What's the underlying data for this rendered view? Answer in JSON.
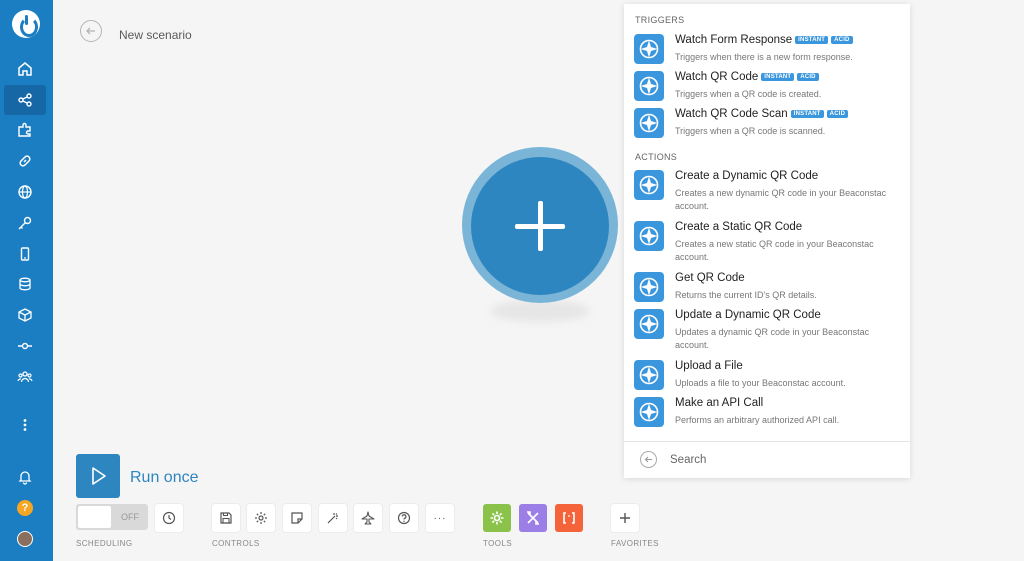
{
  "header": {
    "scenario_title": "New scenario"
  },
  "panel": {
    "triggers_label": "TRIGGERS",
    "actions_label": "ACTIONS",
    "triggers": [
      {
        "title": "Watch Form Response",
        "badges": [
          "INSTANT",
          "ACID"
        ],
        "desc": "Triggers when there is a new form response."
      },
      {
        "title": "Watch QR Code",
        "badges": [
          "INSTANT",
          "ACID"
        ],
        "desc": "Triggers when a QR code is created."
      },
      {
        "title": "Watch QR Code Scan",
        "badges": [
          "INSTANT",
          "ACID"
        ],
        "desc": "Triggers when a QR code is scanned."
      }
    ],
    "actions": [
      {
        "title": "Create a Dynamic QR Code",
        "desc": "Creates a new dynamic QR code in your Beaconstac account."
      },
      {
        "title": "Create a Static QR Code",
        "desc": "Creates a new static QR code in your Beaconstac account."
      },
      {
        "title": "Get QR Code",
        "desc": "Returns the current ID's QR details."
      },
      {
        "title": "Update a Dynamic QR Code",
        "desc": "Updates a dynamic QR code in your Beaconstac account."
      },
      {
        "title": "Upload a File",
        "desc": "Uploads a file to your Beaconstac account."
      },
      {
        "title": "Make an API Call",
        "desc": "Performs an arbitrary authorized API call."
      }
    ],
    "search_placeholder": "Search"
  },
  "toolbar": {
    "run_once_label": "Run once",
    "scheduling_toggle": "OFF",
    "labels": {
      "scheduling": "SCHEDULING",
      "controls": "CONTROLS",
      "tools": "TOOLS",
      "favorites": "FAVORITES"
    },
    "more_label": "···"
  },
  "sidebar": {
    "help_label": "?"
  },
  "colors": {
    "sidebar": "#1b7ec2",
    "accent": "#2e86c1",
    "module_icon": "#3a96dd",
    "tools_green": "#8bc34a",
    "tools_purple": "#9b7fe6",
    "tools_red": "#f4633a"
  }
}
